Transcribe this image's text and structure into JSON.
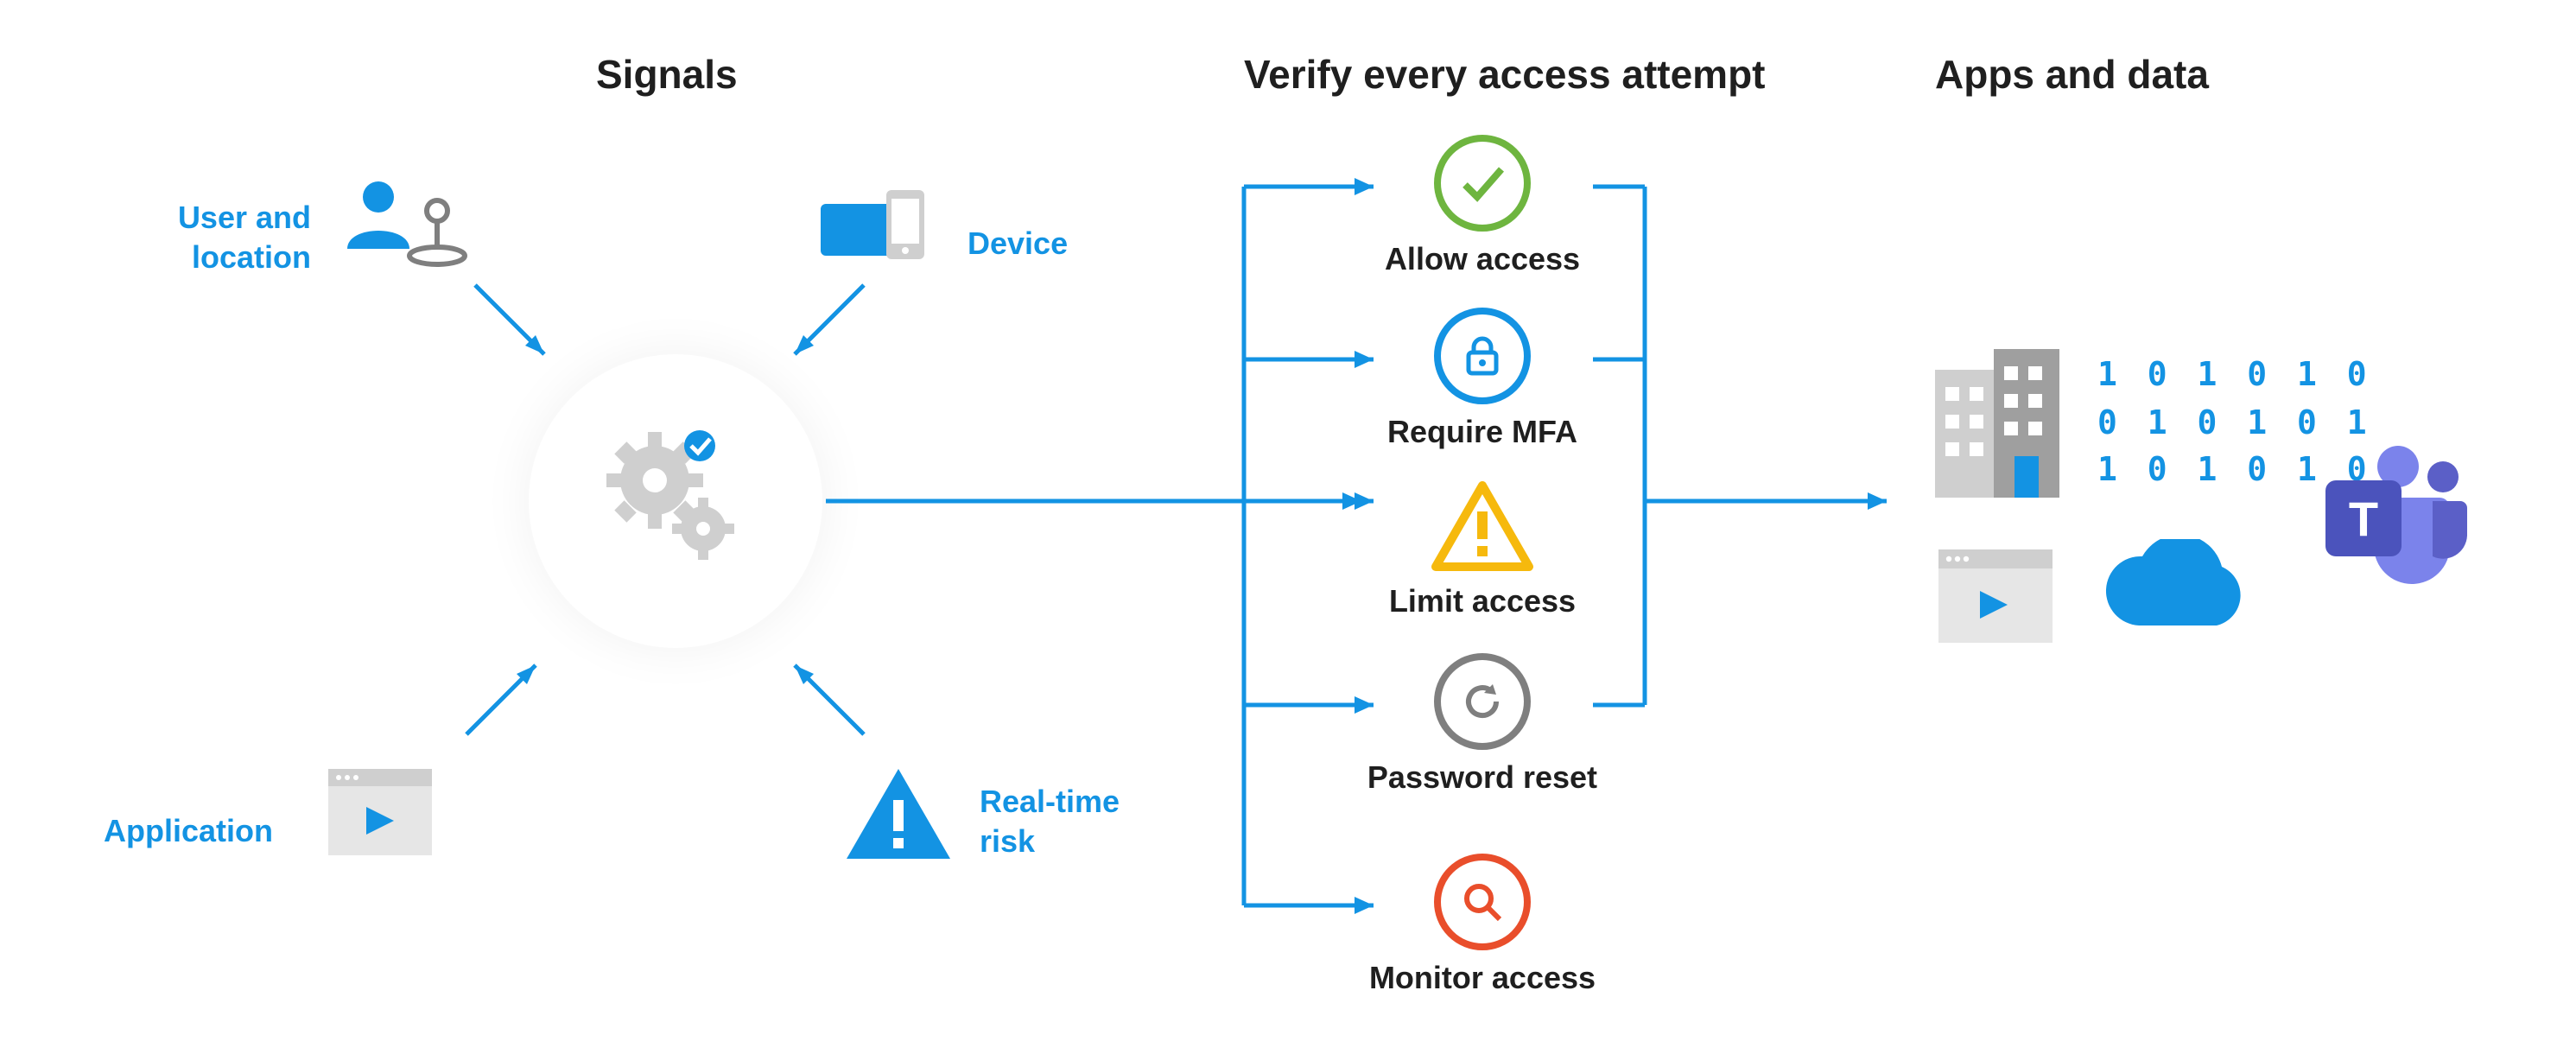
{
  "headings": {
    "signals": "Signals",
    "verify": "Verify every access attempt",
    "apps": "Apps and data"
  },
  "signals": {
    "user_location": "User and\nlocation",
    "device": "Device",
    "application": "Application",
    "realtime_risk": "Real-time\nrisk"
  },
  "actions": {
    "allow": "Allow access",
    "mfa": "Require MFA",
    "limit": "Limit access",
    "password": "Password reset",
    "monitor": "Monitor access"
  },
  "apps_icons": {
    "building": "building-icon",
    "binary": "binary-data-icon",
    "browser": "browser-icon",
    "cloud": "cloud-icon",
    "teams": "teams-icon"
  },
  "binary_text": "1 0 1 0 1 0\n0 1 0 1 0 1\n1 0 1 0 1 0",
  "colors": {
    "blue": "#1393e3",
    "green": "#6eb53f",
    "amber": "#f6b90d",
    "gray": "#7f7f7f",
    "red": "#e94e2b",
    "teams": "#5b5fc7"
  }
}
